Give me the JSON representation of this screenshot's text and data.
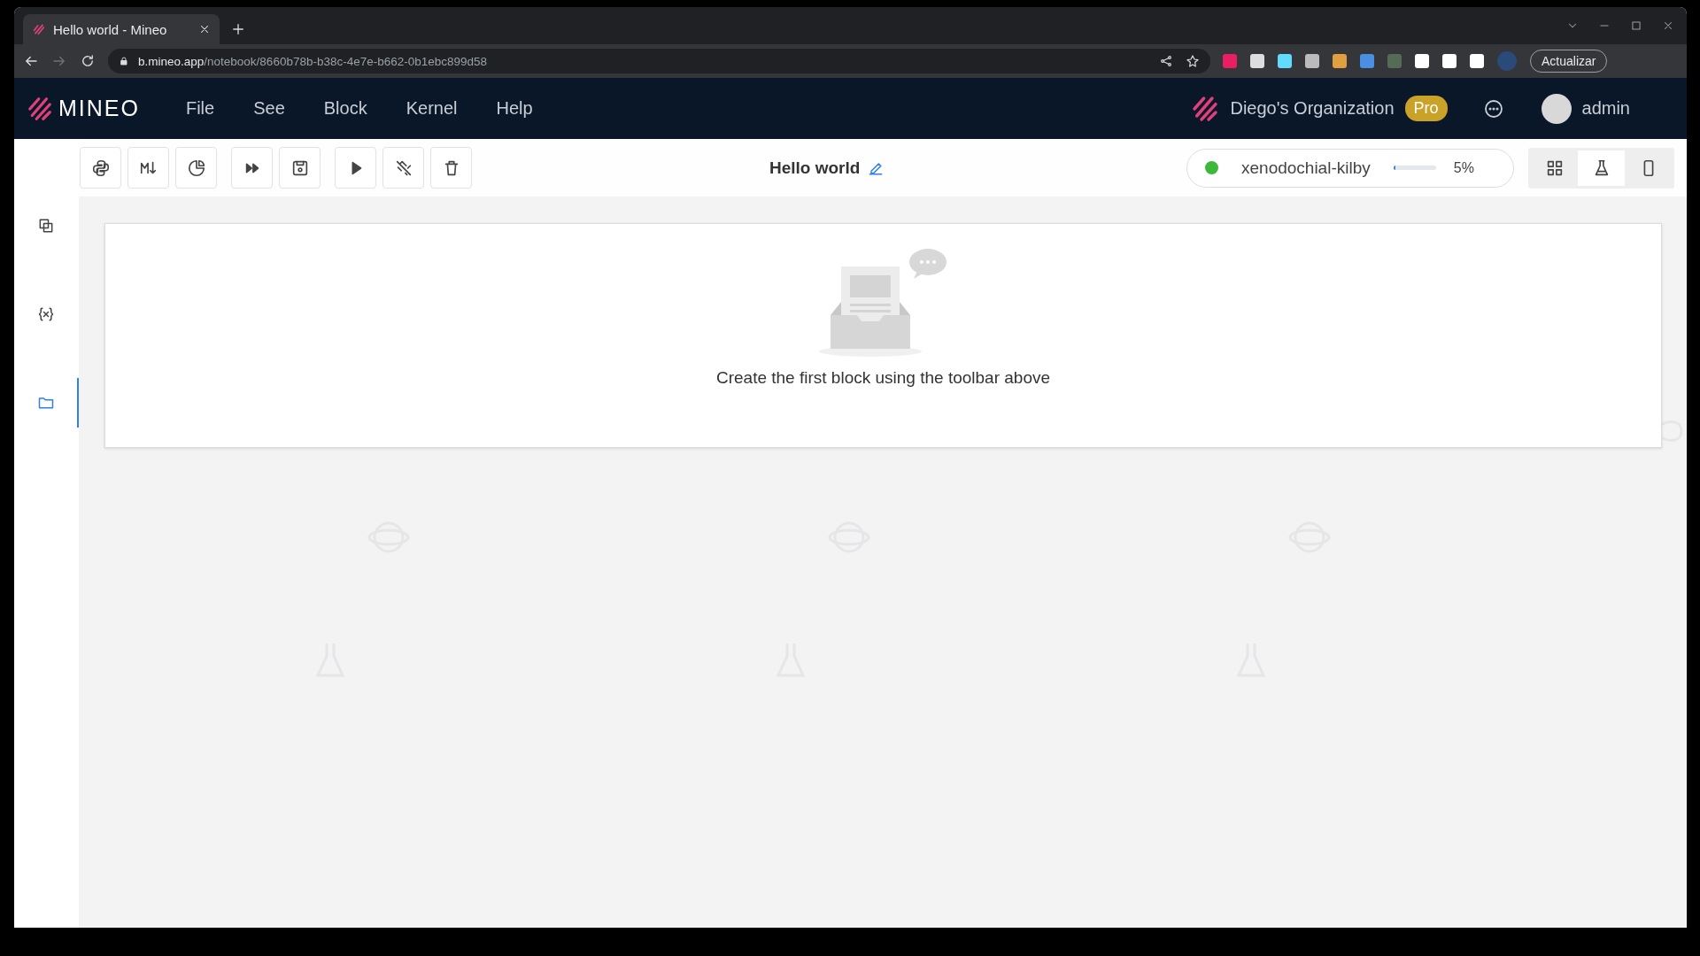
{
  "browser": {
    "tab": {
      "title": "Hello world - Mineo"
    },
    "url": {
      "host": "b.mineo.app",
      "path": "/notebook/8660b78b-b38c-4e7e-b662-0b1ebc899d58"
    },
    "update_button": "Actualizar"
  },
  "header": {
    "logo": "MINEO",
    "menu": [
      "File",
      "See",
      "Block",
      "Kernel",
      "Help"
    ],
    "organization": "Diego's Organization",
    "plan_badge": "Pro",
    "user": "admin"
  },
  "sidebar": {
    "items": [
      {
        "selected": false
      },
      {
        "selected": false
      },
      {
        "selected": true
      }
    ]
  },
  "notebook": {
    "title": "Hello world"
  },
  "kernel": {
    "name": "xenodochial-kilby",
    "level": 0.05,
    "reading": "5%"
  },
  "view_modes": [
    {
      "selected": false
    },
    {
      "selected": true
    },
    {
      "selected": false
    }
  ],
  "empty_state": {
    "message": "Create the first block using the toolbar above"
  }
}
